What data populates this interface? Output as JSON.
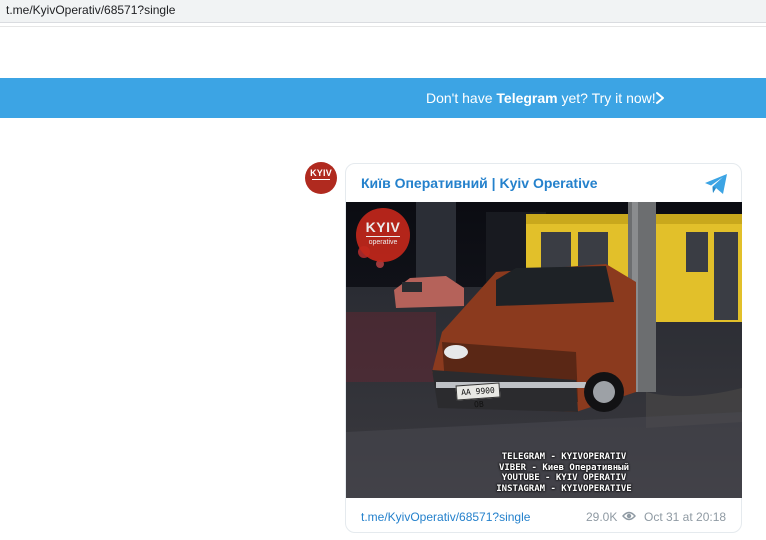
{
  "address_bar": {
    "url": "t.me/KyivOperativ/68571?single"
  },
  "banner": {
    "prefix": "Don't have ",
    "brand": "Telegram",
    "suffix": " yet? Try it now!",
    "color": "#3ca4e4"
  },
  "post": {
    "avatar_text": "KYIV",
    "channel_name": "Київ Оперативний | Kyiv Operative",
    "channel_icon": "telegram-icon",
    "photo": {
      "logo_text": "KYIV",
      "logo_sub": "operative",
      "plate": "AA 9900 OB",
      "overlay_lines": [
        "TELEGRAM - KYIVOPERATIV",
        "VIBER - Киев Оперативный",
        "YOUTUBE - KYIV OPERATIV",
        "INSTAGRAM - KYIVOPERATIVE"
      ]
    },
    "footer": {
      "link": "t.me/KyivOperativ/68571?single",
      "views": "29.0K",
      "views_icon": "eye-icon",
      "date": "Oct 31 at 20:18"
    },
    "link_color": "#2481cc"
  }
}
